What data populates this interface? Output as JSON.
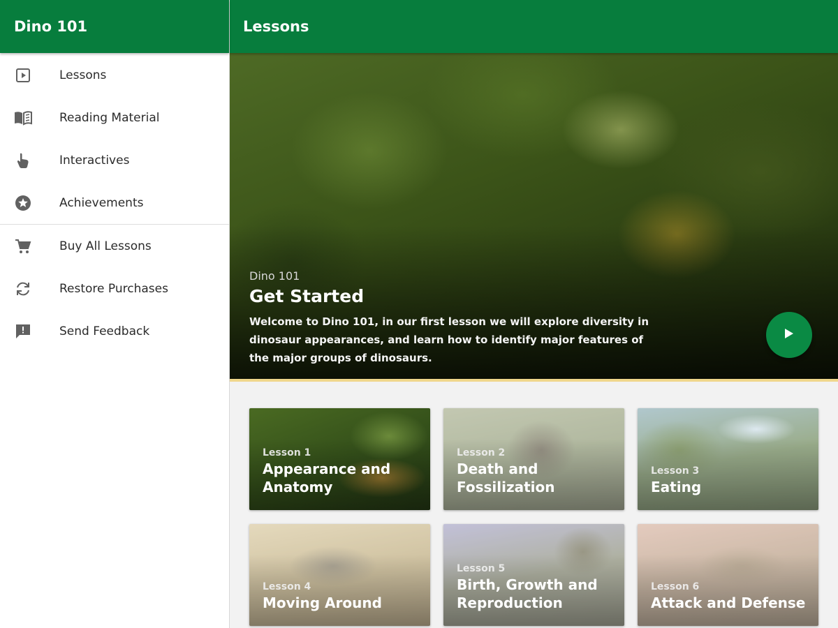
{
  "sidebar": {
    "title": "Dino 101",
    "items": [
      {
        "label": "Lessons",
        "icon": "play-box-icon"
      },
      {
        "label": "Reading Material",
        "icon": "book-icon"
      },
      {
        "label": "Interactives",
        "icon": "pointer-hand-icon"
      },
      {
        "label": "Achievements",
        "icon": "star-circle-icon"
      }
    ],
    "items_secondary": [
      {
        "label": "Buy All Lessons",
        "icon": "cart-icon"
      },
      {
        "label": "Restore Purchases",
        "icon": "refresh-icon"
      },
      {
        "label": "Send Feedback",
        "icon": "feedback-icon"
      }
    ]
  },
  "header": {
    "title": "Lessons"
  },
  "hero": {
    "kicker": "Dino 101",
    "title": "Get Started",
    "description": "Welcome to Dino 101, in our first lesson we will explore diversity in dinosaur appearances, and learn how to identify major features of the major groups of dinosaurs."
  },
  "lessons": [
    {
      "number": "Lesson 1",
      "title": "Appearance and Anatomy"
    },
    {
      "number": "Lesson 2",
      "title": "Death and Fossilization"
    },
    {
      "number": "Lesson 3",
      "title": "Eating"
    },
    {
      "number": "Lesson 4",
      "title": "Moving Around"
    },
    {
      "number": "Lesson 5",
      "title": "Birth, Growth and Reproduction"
    },
    {
      "number": "Lesson 6",
      "title": "Attack and Defense"
    }
  ],
  "colors": {
    "appbar": "#077d3d",
    "play_button": "#0a8a44",
    "hero_accent_line": "#f0d78c",
    "icon_gray": "#616161"
  }
}
